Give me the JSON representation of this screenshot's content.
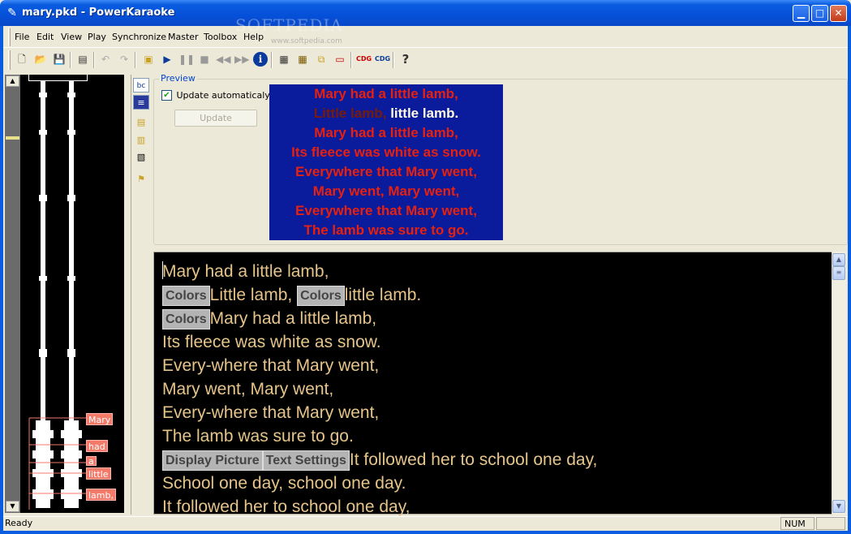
{
  "window": {
    "title": "mary.pkd - PowerKaraoke",
    "watermark": "SOFTPEDIA",
    "watermark_url": "www.softpedia.com"
  },
  "menu": [
    "File",
    "Edit",
    "View",
    "Play",
    "Synchronize",
    "Master",
    "Toolbox",
    "Help"
  ],
  "waveform_labels": [
    "Mary",
    "had",
    "a",
    "little",
    "lamb,"
  ],
  "preview": {
    "legend": "Preview",
    "update_auto_label": "Update automaticaly",
    "update_auto_checked": true,
    "update_button": "Update",
    "lines": [
      {
        "parts": [
          {
            "t": "Mary had a little lamb,",
            "c": "red"
          }
        ]
      },
      {
        "parts": [
          {
            "t": "Little lamb, ",
            "c": "dark"
          },
          {
            "t": "little lamb.",
            "c": "white"
          }
        ]
      },
      {
        "parts": [
          {
            "t": "Mary had a little lamb,",
            "c": "red"
          }
        ]
      },
      {
        "parts": [
          {
            "t": "Its fleece was white as snow.",
            "c": "red"
          }
        ]
      },
      {
        "parts": [
          {
            "t": "Everywhere that Mary went,",
            "c": "red"
          }
        ]
      },
      {
        "parts": [
          {
            "t": "Mary went, Mary went,",
            "c": "red"
          }
        ]
      },
      {
        "parts": [
          {
            "t": "Everywhere that Mary went,",
            "c": "red"
          }
        ]
      },
      {
        "parts": [
          {
            "t": "The lamb was sure to go.",
            "c": "red"
          }
        ]
      }
    ],
    "colors": {
      "background": "#0a1c9c",
      "sung": "#7a1a08",
      "current": "#fffbe0",
      "unsung": "#e8200e"
    }
  },
  "lyrics": {
    "text_color": "#e6c48a",
    "lines": [
      [
        "Mary had a little lamb,"
      ],
      [
        {
          "tag": "Colors"
        },
        "Little lamb, ",
        {
          "tag": "Colors"
        },
        "little lamb."
      ],
      [
        {
          "tag": "Colors"
        },
        "Mary had a little lamb,"
      ],
      [
        "Its fleece was white as snow."
      ],
      [
        "Every-where that Mary went,"
      ],
      [
        "Mary went, Mary went,"
      ],
      [
        "Every-where that Mary went,"
      ],
      [
        "The lamb was sure to go."
      ],
      [
        {
          "tag": "Display Picture"
        },
        {
          "tag": "Text Settings"
        },
        "It followed her to school one day,"
      ],
      [
        "School one day, school one day."
      ],
      [
        "It followed her to school one day,"
      ]
    ]
  },
  "status": {
    "text": "Ready",
    "num": "NUM"
  }
}
